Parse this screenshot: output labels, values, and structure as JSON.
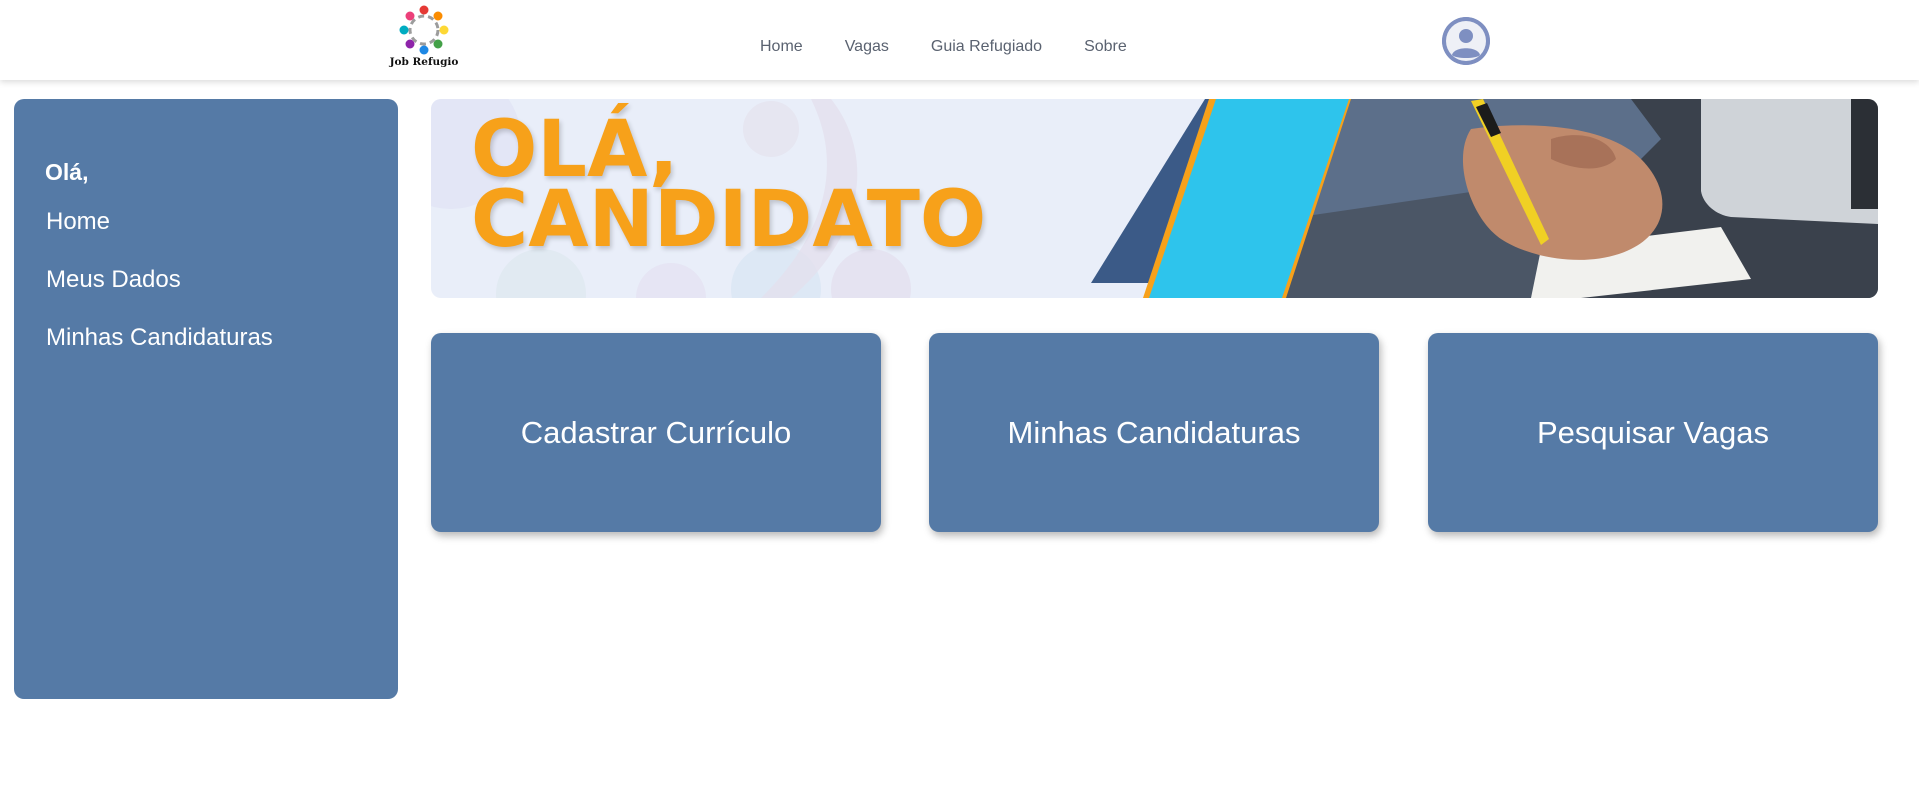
{
  "header": {
    "logo_text": "Job Refugio",
    "nav": [
      {
        "label": "Home"
      },
      {
        "label": "Vagas"
      },
      {
        "label": "Guia Refugiado"
      },
      {
        "label": "Sobre"
      }
    ],
    "avatar_icon": "user-avatar-icon"
  },
  "sidebar": {
    "greeting": "Olá,",
    "items": [
      {
        "label": "Home"
      },
      {
        "label": "Meus Dados"
      },
      {
        "label": "Minhas Candidaturas"
      }
    ]
  },
  "banner": {
    "line1": "OLÁ,",
    "line2": "CANDIDATO"
  },
  "cards": [
    {
      "label": "Cadastrar Currículo"
    },
    {
      "label": "Minhas Candidaturas"
    },
    {
      "label": "Pesquisar Vagas"
    }
  ],
  "colors": {
    "primary": "#557aa6",
    "accent_orange": "#f7a11a",
    "accent_cyan": "#2ec4ec",
    "accent_navy": "#3b5a87",
    "avatar": "#7e8fc1"
  }
}
